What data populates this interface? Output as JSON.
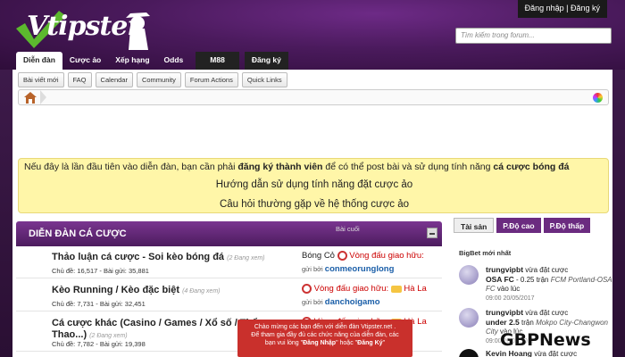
{
  "header": {
    "logo_text": "Vtipster",
    "login_label": "Đăng nhập",
    "register_label": "Đăng ký",
    "search_placeholder": "Tìm kiếm trong forum..."
  },
  "nav": {
    "tabs": [
      "Diễn đàn",
      "Cược ảo",
      "Xếp hạng",
      "Odds",
      "M88",
      "Đăng ký"
    ]
  },
  "subnav": [
    "Bài viết mới",
    "FAQ",
    "Calendar",
    "Community",
    "Forum Actions",
    "Quick Links"
  ],
  "notice": {
    "prefix": "Nếu đây là lần đầu tiên vào diễn đàn, bạn cần phải ",
    "bold1": "đăng ký thành viên",
    "middle": " để có thể post bài và sử dụng tính năng ",
    "bold2": "cá cược bóng đá",
    "link1": "Hướng dẫn sử dụng tính năng đặt cược ảo",
    "link2": "Câu hỏi thường gặp về hệ thống cược ảo"
  },
  "forum": {
    "title": "DIỄN ĐÀN CÁ CƯỢC",
    "last_post_header": "Bài cuối",
    "rows": [
      {
        "title": "Thảo luận cá cược - Soi kèo bóng đá",
        "viewing": "(2 Đang xem)",
        "topics_label": "Chủ đề:",
        "topics": "16,517",
        "posts_label": "- Bài gửi:",
        "posts": "35,881",
        "last_thread": "Bóng Cỏ",
        "last_thread2": "Vòng đấu giao hữu:",
        "by_label": "gửi bởi",
        "by_user": "conmeorunglong"
      },
      {
        "title": "Kèo Running / Kèo đặc biệt",
        "viewing": "(4 Đang xem)",
        "topics_label": "Chủ đề:",
        "topics": "7,731",
        "posts_label": "- Bài gửi:",
        "posts": "32,451",
        "last_thread": "Vòng đấu giao hữu:",
        "last_thread2": "Hà La",
        "by_label": "gửi bởi",
        "by_user": "danchoigamo"
      },
      {
        "title": "Cá cược khác (Casino / Games / Xổ số / Thể Thao...)",
        "viewing": "(2 Đang xem)",
        "topics_label": "Chủ đề:",
        "topics": "7,782",
        "posts_label": "- Bài gửi:",
        "posts": "19,398",
        "last_thread": "Vòng đấu giao hữu:",
        "last_thread2": "Hà La",
        "by_label": "",
        "by_user": ""
      }
    ]
  },
  "toast": {
    "line1": "Chào mừng các bạn đến với diễn đàn Vtipster.net .",
    "line2": "Để tham gia đầy đủ các chức năng của diễn đàn, các",
    "line3_prefix": "bạn vui lòng ",
    "login": "Đăng Nhập",
    "or": " hoặc ",
    "register": "Đăng Ký"
  },
  "right": {
    "tabs": [
      "Tài sản",
      "P.Độ cao",
      "P.Độ thấp"
    ],
    "heading": "BigBet mới nhất",
    "items": [
      {
        "user": "trungvipbt",
        "action": "vừa đặt cược",
        "bet": "OSA FC",
        "odds": "- 0.25 trận",
        "match": "FCM Portland-OSA FC",
        "tail": "vào lúc",
        "time": "09:00 20/05/2017"
      },
      {
        "user": "trungvipbt",
        "action": "vừa đặt cược",
        "bet": "under 2.5",
        "odds": "trận",
        "match": "Mokpo City-Changwon City",
        "tail": "vào lúc",
        "time": "09:00 20/05/2017"
      },
      {
        "user": "Kevin Hoang",
        "action": "vừa đặt cược",
        "bet": "",
        "odds": "",
        "match": "",
        "tail": "",
        "time": ""
      }
    ]
  },
  "watermark": "GBPNews",
  "colors": {
    "brand_purple": "#5a1f6e",
    "notice_bg": "#fff6a8",
    "toast_bg": "#c9302c",
    "link_blue": "#1a5ea8"
  }
}
